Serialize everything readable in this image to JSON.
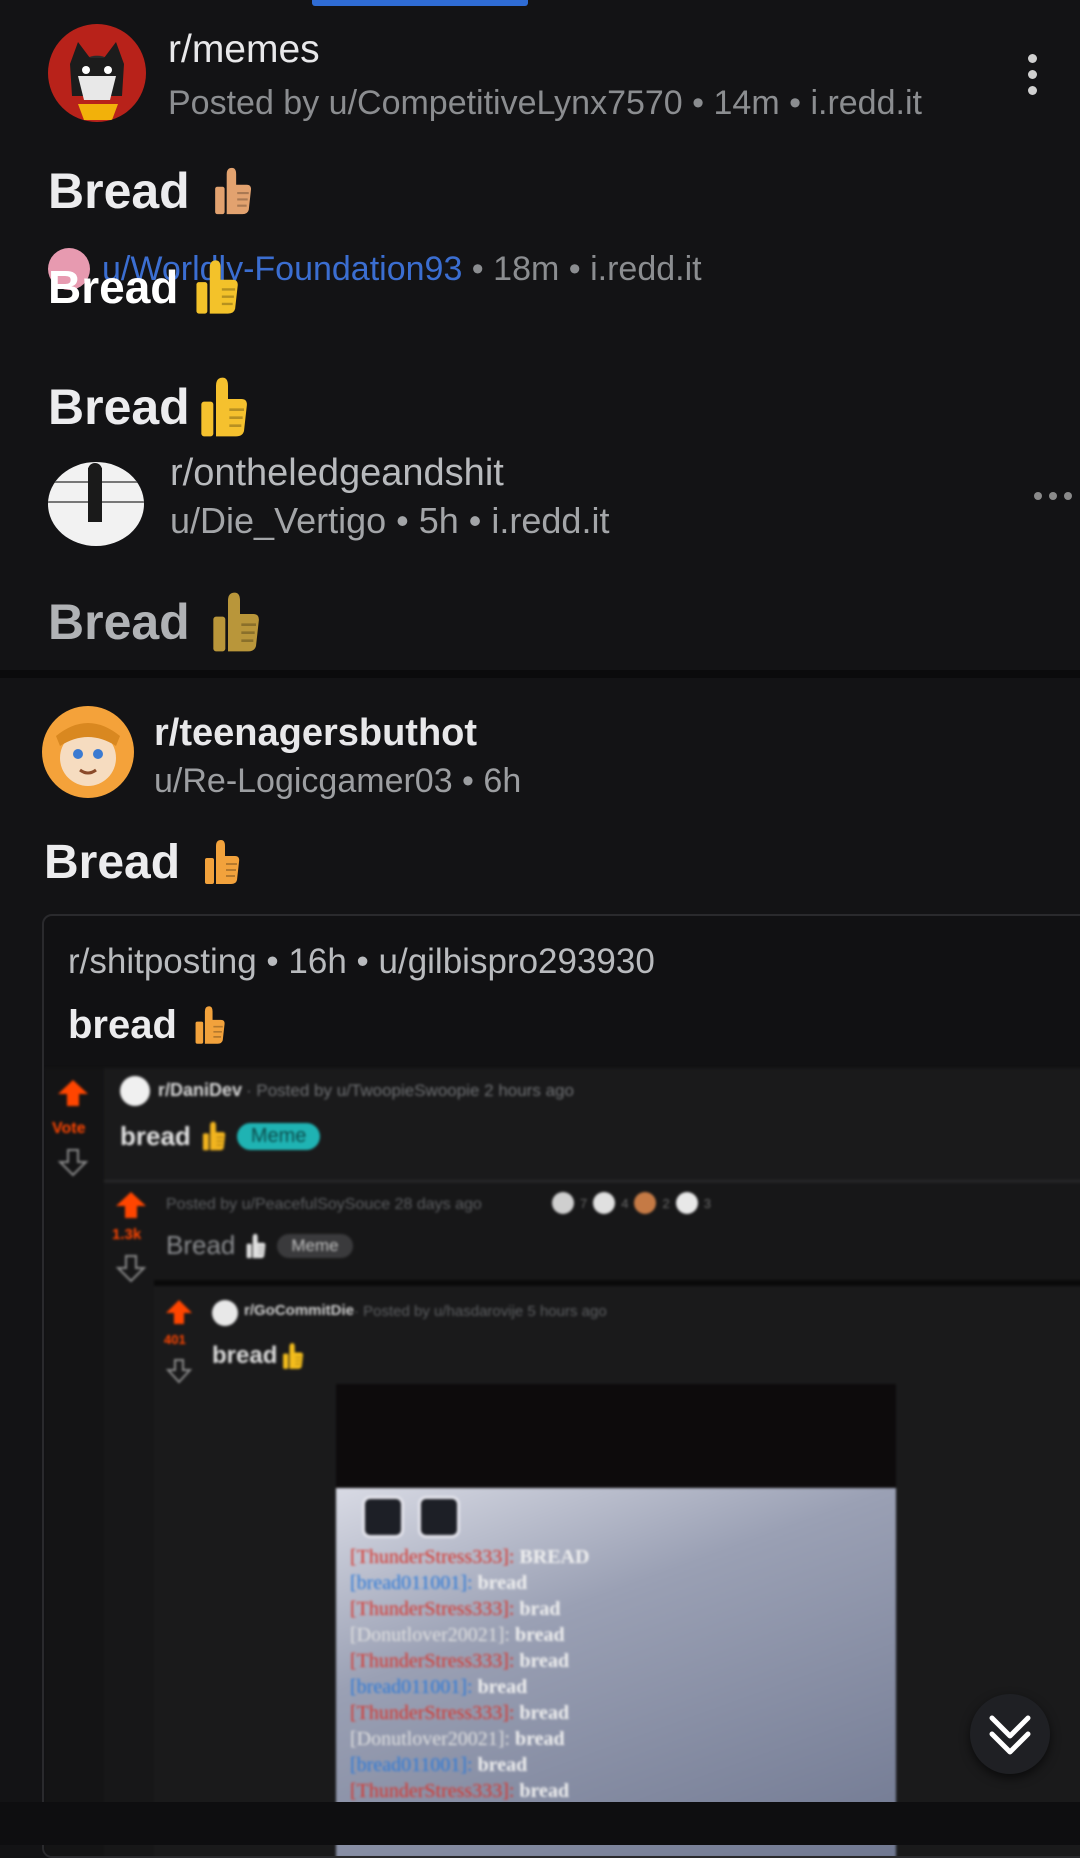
{
  "post1": {
    "subreddit": "r/memes",
    "meta": "Posted by u/CompetitiveLynx7570 • 14m • i.redd.it",
    "title": "Bread"
  },
  "post2": {
    "author": "u/Worldly-Foundation93",
    "meta": " • 18m • i.redd.it",
    "title": "Bread"
  },
  "post3": {
    "title": "Bread",
    "subreddit": "r/ontheledgeandshit",
    "meta": "u/Die_Vertigo • 5h • i.redd.it",
    "title2": "Bread"
  },
  "post4": {
    "subreddit": "r/teenagersbuthot",
    "meta": "u/Re-Logicgamer03 • 6h",
    "title": "Bread"
  },
  "crosspost": {
    "meta": "r/shitposting • 16h • u/gilbispro293930",
    "title": "bread"
  },
  "nested1": {
    "vote_label": "Vote",
    "subreddit": "r/DaniDev",
    "meta": "· Posted by u/TwoopieSwoopie 2 hours ago",
    "title": "bread",
    "flair": "Meme"
  },
  "nested2": {
    "votes": "1.3k",
    "meta": "Posted by u/PeacefulSoySouce 28 days ago",
    "awards": [
      "7",
      "4",
      "2",
      "3"
    ],
    "title": "Bread",
    "flair": "Meme"
  },
  "nested3": {
    "votes": "401",
    "subreddit": "r/GoCommitDie",
    "meta": "· Posted by u/hasdarovije 5 hours ago",
    "title": "bread"
  },
  "chat": {
    "lines": [
      {
        "name": "[ThunderStress333]:",
        "msg": "BREAD",
        "color": "#d8342c"
      },
      {
        "name": "[bread011001]:",
        "msg": "bread",
        "color": "#2c79d8"
      },
      {
        "name": "[ThunderStress333]:",
        "msg": "brad",
        "color": "#d8342c"
      },
      {
        "name": "[Donutlover20021]:",
        "msg": "bread",
        "color": "#e0e0e0"
      },
      {
        "name": "[ThunderStress333]:",
        "msg": "bread",
        "color": "#d8342c"
      },
      {
        "name": "[bread011001]:",
        "msg": "bread",
        "color": "#2c79d8"
      },
      {
        "name": "[ThunderStress333]:",
        "msg": "bread",
        "color": "#d8342c"
      },
      {
        "name": "[Donutlover20021]:",
        "msg": "bread",
        "color": "#e0e0e0"
      },
      {
        "name": "[bread011001]:",
        "msg": "bread",
        "color": "#2c79d8"
      },
      {
        "name": "[ThunderStress333]:",
        "msg": "bread",
        "color": "#d8342c"
      }
    ]
  },
  "icons": {
    "thumb": "thumbs-up-icon",
    "more": "more-vertical-icon",
    "scroll": "double-chevron-down-icon"
  },
  "colors": {
    "background": "#131315",
    "link": "#3b6ed1",
    "upvote": "#ff4500",
    "flair": "#1fb3b3"
  }
}
